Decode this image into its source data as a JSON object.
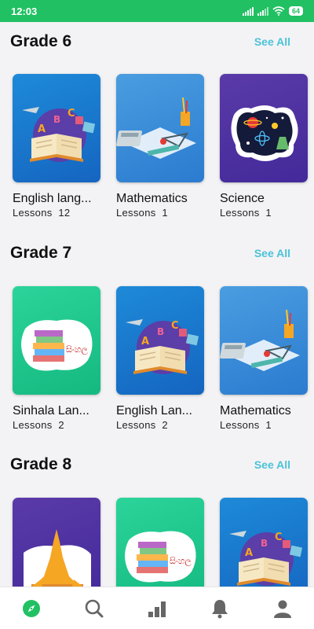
{
  "status_bar": {
    "time": "12:03",
    "battery": "64"
  },
  "sections": [
    {
      "title": "Grade 6",
      "see_all": "See All",
      "cards": [
        {
          "title": "English lang...",
          "lessons_label": "Lessons",
          "lessons": "12",
          "art": "english"
        },
        {
          "title": "Mathematics",
          "lessons_label": "Lessons",
          "lessons": "1",
          "art": "math"
        },
        {
          "title": "Science",
          "lessons_label": "Lessons",
          "lessons": "1",
          "art": "science"
        }
      ]
    },
    {
      "title": "Grade 7",
      "see_all": "See All",
      "cards": [
        {
          "title": "Sinhala Lan...",
          "lessons_label": "Lessons",
          "lessons": "2",
          "art": "sinhala"
        },
        {
          "title": "English Lan...",
          "lessons_label": "Lessons",
          "lessons": "2",
          "art": "english"
        },
        {
          "title": "Mathematics",
          "lessons_label": "Lessons",
          "lessons": "1",
          "art": "math"
        }
      ]
    },
    {
      "title": "Grade 8",
      "see_all": "See All",
      "cards": [
        {
          "title": "",
          "lessons_label": "",
          "lessons": "",
          "art": "buddhism"
        },
        {
          "title": "",
          "lessons_label": "",
          "lessons": "",
          "art": "sinhala"
        },
        {
          "title": "",
          "lessons_label": "",
          "lessons": "",
          "art": "english"
        }
      ]
    }
  ],
  "bottom_nav": [
    {
      "icon": "compass-icon",
      "active": true
    },
    {
      "icon": "search-icon",
      "active": false
    },
    {
      "icon": "bar-chart-icon",
      "active": false
    },
    {
      "icon": "bell-icon",
      "active": false
    },
    {
      "icon": "profile-icon",
      "active": false
    }
  ],
  "colors": {
    "status_bar": "#21c063",
    "accent": "#4cc2d8",
    "active_nav": "#21c063",
    "inactive_nav": "#666666"
  }
}
